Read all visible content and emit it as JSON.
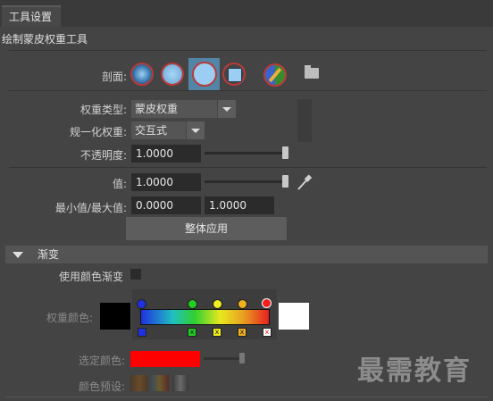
{
  "tabs": {
    "active": "工具设置"
  },
  "tool_title": "绘制蒙皮权重工具",
  "profile": {
    "label": "剖面:"
  },
  "weight_type": {
    "label": "权重类型:",
    "value": "蒙皮权重"
  },
  "normalize": {
    "label": "规一化权重:",
    "value": "交互式"
  },
  "opacity": {
    "label": "不透明度:",
    "value": "1.0000",
    "slider": 1.0
  },
  "value_row": {
    "label": "值:",
    "value": "1.0000",
    "slider": 1.0
  },
  "minmax": {
    "label": "最小值/最大值:",
    "min": "0.0000",
    "max": "1.0000"
  },
  "flood_button": "整体应用",
  "gradient_section": {
    "title": "渐变",
    "use_color_ramp": "使用颜色渐变",
    "weight_color": "权重颜色:",
    "selected_color": "选定颜色:",
    "color_presets": "颜色预设:",
    "selected_color_hex": "#ff0000",
    "weight_color_min_hex": "#000000",
    "weight_color_max_hex": "#ffffff"
  },
  "watermark": "最需教育"
}
